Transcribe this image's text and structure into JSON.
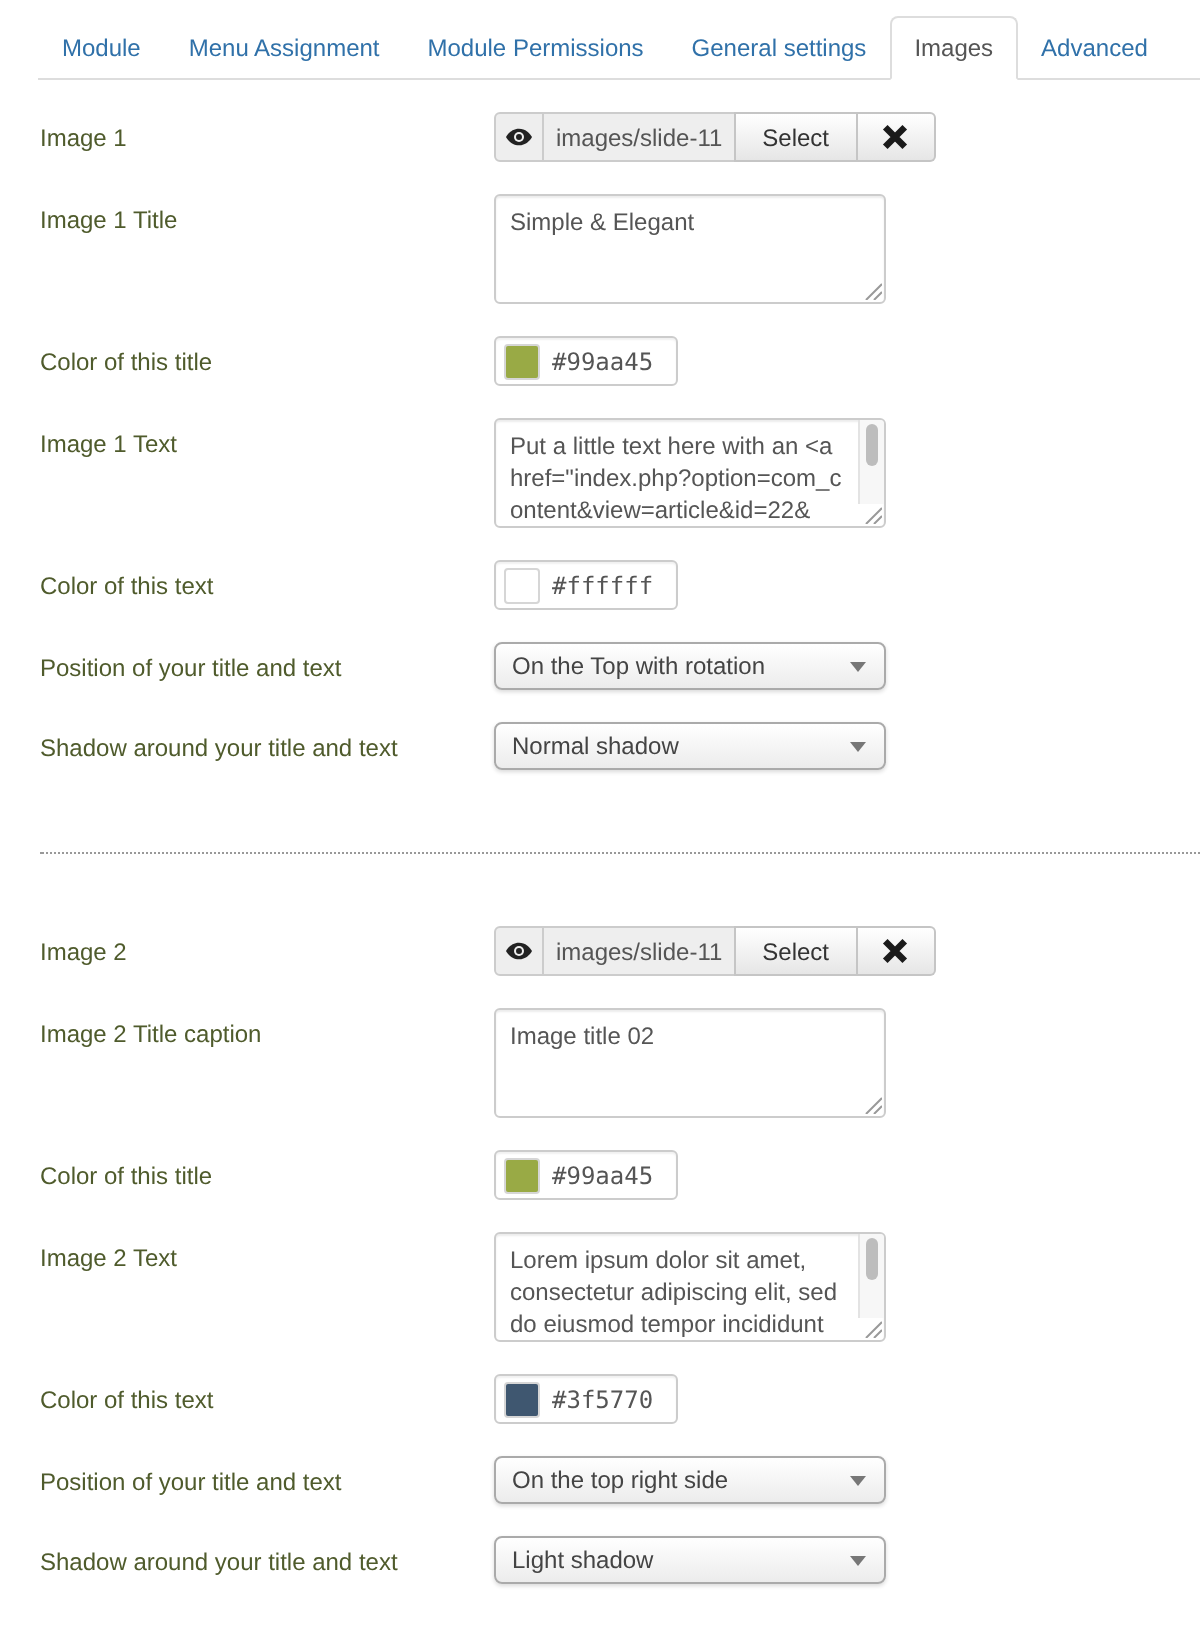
{
  "tabs": [
    {
      "label": "Module",
      "selected": false
    },
    {
      "label": "Menu Assignment",
      "selected": false
    },
    {
      "label": "Module Permissions",
      "selected": false
    },
    {
      "label": "General settings",
      "selected": false
    },
    {
      "label": "Images",
      "selected": true
    },
    {
      "label": "Advanced",
      "selected": false
    }
  ],
  "sections": [
    {
      "fields": [
        {
          "kind": "media",
          "label": "Image 1",
          "value": "images/slide-11",
          "button": "Select"
        },
        {
          "kind": "textarea",
          "label": "Image 1 Title",
          "value": "Simple & Elegant",
          "scrollbar": false
        },
        {
          "kind": "color",
          "label": "Color of this title",
          "value": "#99aa45",
          "color": "#99aa45"
        },
        {
          "kind": "textarea",
          "label": "Image 1 Text",
          "value": "Put a little text here with an <a href=\"index.php?option=com_content&view=article&id=22&",
          "scrollbar": true
        },
        {
          "kind": "color",
          "label": "Color of this text",
          "value": "#ffffff",
          "color": "#ffffff"
        },
        {
          "kind": "select",
          "label": "Position of your title and text",
          "value": "On the Top with rotation"
        },
        {
          "kind": "select",
          "label": "Shadow around your title and text",
          "value": "Normal shadow"
        }
      ]
    },
    {
      "fields": [
        {
          "kind": "media",
          "label": "Image 2",
          "value": "images/slide-11",
          "button": "Select"
        },
        {
          "kind": "textarea",
          "label": "Image 2 Title caption",
          "value": "Image title 02",
          "scrollbar": false
        },
        {
          "kind": "color",
          "label": "Color of this title",
          "value": "#99aa45",
          "color": "#99aa45"
        },
        {
          "kind": "textarea",
          "label": "Image 2 Text",
          "value": "Lorem ipsum dolor sit amet, consectetur adipiscing elit, sed do eiusmod tempor incididunt",
          "scrollbar": true
        },
        {
          "kind": "color",
          "label": "Color of this text",
          "value": "#3f5770",
          "color": "#3f5770"
        },
        {
          "kind": "select",
          "label": "Position of your title and text",
          "value": "On the top right side"
        },
        {
          "kind": "select",
          "label": "Shadow around your title and text",
          "value": "Light shadow"
        }
      ]
    }
  ]
}
